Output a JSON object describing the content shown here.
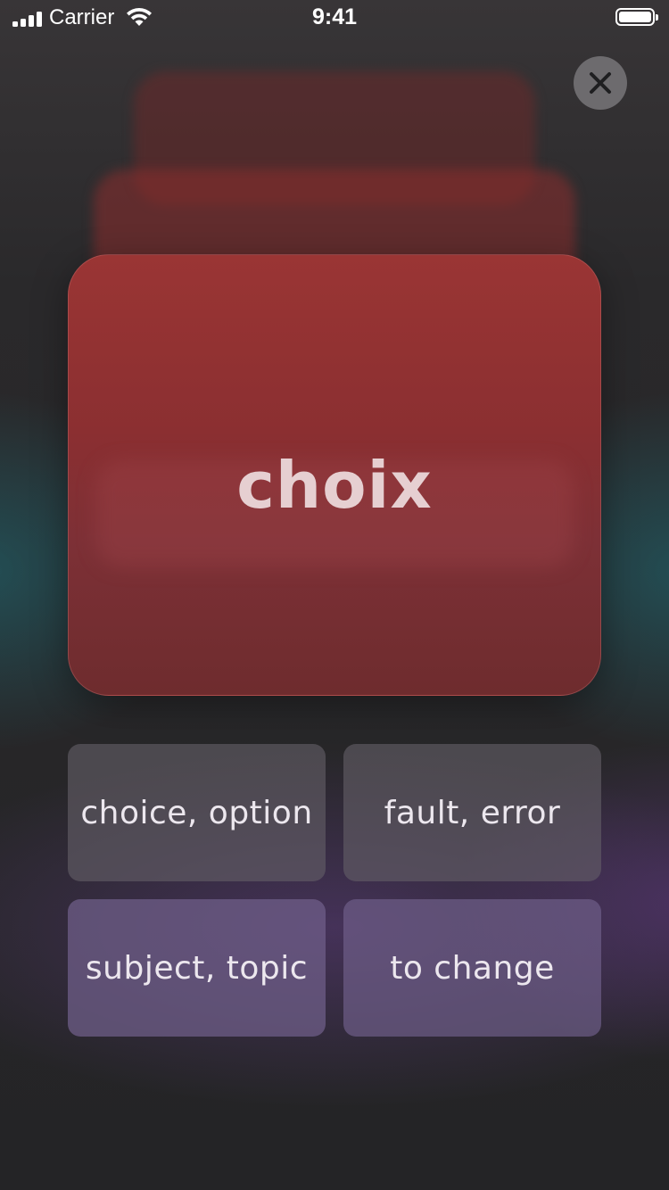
{
  "status_bar": {
    "carrier": "Carrier",
    "time": "9:41"
  },
  "close": {
    "icon": "close-icon"
  },
  "card": {
    "word": "choix"
  },
  "answers": [
    {
      "label": "choice, option"
    },
    {
      "label": "fault, error"
    },
    {
      "label": "subject, topic"
    },
    {
      "label": "to change"
    }
  ],
  "colors": {
    "card": "#8f3132",
    "card_text": "#e6cfd1",
    "answer_text": "#ece7ee",
    "background": "#242426"
  }
}
